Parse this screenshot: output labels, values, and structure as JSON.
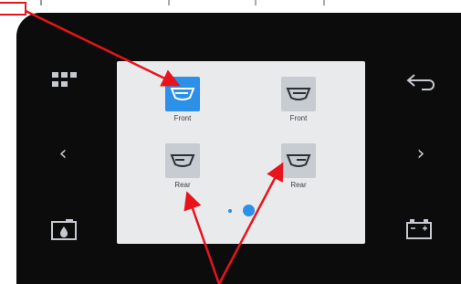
{
  "screen": {
    "tiles": [
      {
        "label": "Front",
        "icon": "front-wiper-icon",
        "selected": true
      },
      {
        "label": "Front",
        "icon": "front-wiper-icon",
        "selected": false
      },
      {
        "label": "Rear",
        "icon": "rear-wiper-icon",
        "selected": false
      },
      {
        "label": "Rear",
        "icon": "rear-wiper-icon",
        "selected": false
      }
    ],
    "pager": {
      "pages": 2,
      "current": 2
    }
  },
  "side_buttons": {
    "left": [
      "grid-menu-icon",
      "chevron-left-icon",
      "washer-fluid-icon"
    ],
    "right": [
      "back-arrow-icon",
      "chevron-right-icon",
      "battery-icon"
    ]
  },
  "glyphs": {
    "prev": "‹",
    "next": "›"
  },
  "colors": {
    "selected_tile": "#2c8fe8",
    "tile": "#c7cbd2",
    "screen_bg": "#e9eaec",
    "bezel": "#0c0c0d",
    "annotation": "#e8141b",
    "pager_active": "#2c8fe8"
  }
}
